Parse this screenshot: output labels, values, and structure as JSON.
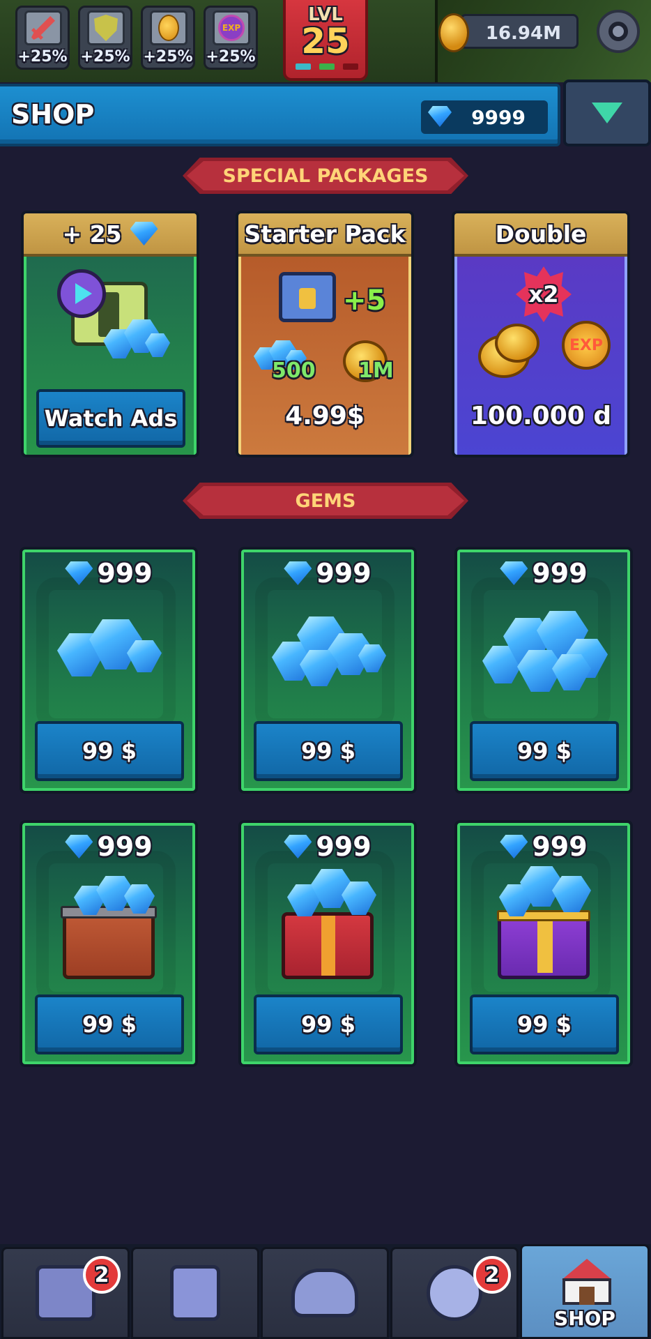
{
  "hud": {
    "buffs": [
      {
        "icon": "sword-icon",
        "value": "+25%"
      },
      {
        "icon": "shield-icon",
        "value": "+25%"
      },
      {
        "icon": "coin-icon",
        "value": "+25%"
      },
      {
        "icon": "exp-icon",
        "value": "+25%",
        "icon_text": "EXP"
      }
    ],
    "level_label": "LVL",
    "level": "25",
    "coins": "16.94M",
    "settings_icon": "gear-icon"
  },
  "shop": {
    "title": "SHOP",
    "gems": "9999",
    "collapse_icon": "triangle-down-icon"
  },
  "sections": {
    "special": "SPECIAL PACKAGES",
    "gems": "GEMS"
  },
  "packages": [
    {
      "header": "+ 25",
      "button": "Watch Ads",
      "icon": "video-ad-icon"
    },
    {
      "header": "Starter Pack",
      "bonus": "+5",
      "gems": "500",
      "coins": "1M",
      "price": "4.99$"
    },
    {
      "header": "Double",
      "multiplier": "x2",
      "exp_label": "EXP",
      "price": "100.000 d"
    }
  ],
  "gem_offers": [
    {
      "amount": "999",
      "price": "99 $",
      "art": "small-gem-pile"
    },
    {
      "amount": "999",
      "price": "99 $",
      "art": "medium-gem-pile"
    },
    {
      "amount": "999",
      "price": "99 $",
      "art": "large-gem-pile"
    },
    {
      "amount": "999",
      "price": "99 $",
      "art": "wooden-gem-chest"
    },
    {
      "amount": "999",
      "price": "99 $",
      "art": "red-gem-chest"
    },
    {
      "amount": "999",
      "price": "99 $",
      "art": "purple-gem-chest"
    }
  ],
  "nav": [
    {
      "name": "chest",
      "icon": "locked-chest-icon",
      "badge": "2"
    },
    {
      "name": "upgrades",
      "icon": "upgrade-book-icon"
    },
    {
      "name": "hero",
      "icon": "viking-helmet-icon"
    },
    {
      "name": "skills",
      "icon": "cog-ring-icon",
      "badge": "2"
    },
    {
      "name": "shop",
      "icon": "shop-house-icon",
      "label": "SHOP"
    }
  ],
  "colors": {
    "background": "#1c1b33",
    "accent_blue": "#1b84c9",
    "card_green": "#27954a",
    "ribbon_red": "#b7303d",
    "ribbon_text": "#ffd478",
    "badge_red": "#e33a3a"
  }
}
